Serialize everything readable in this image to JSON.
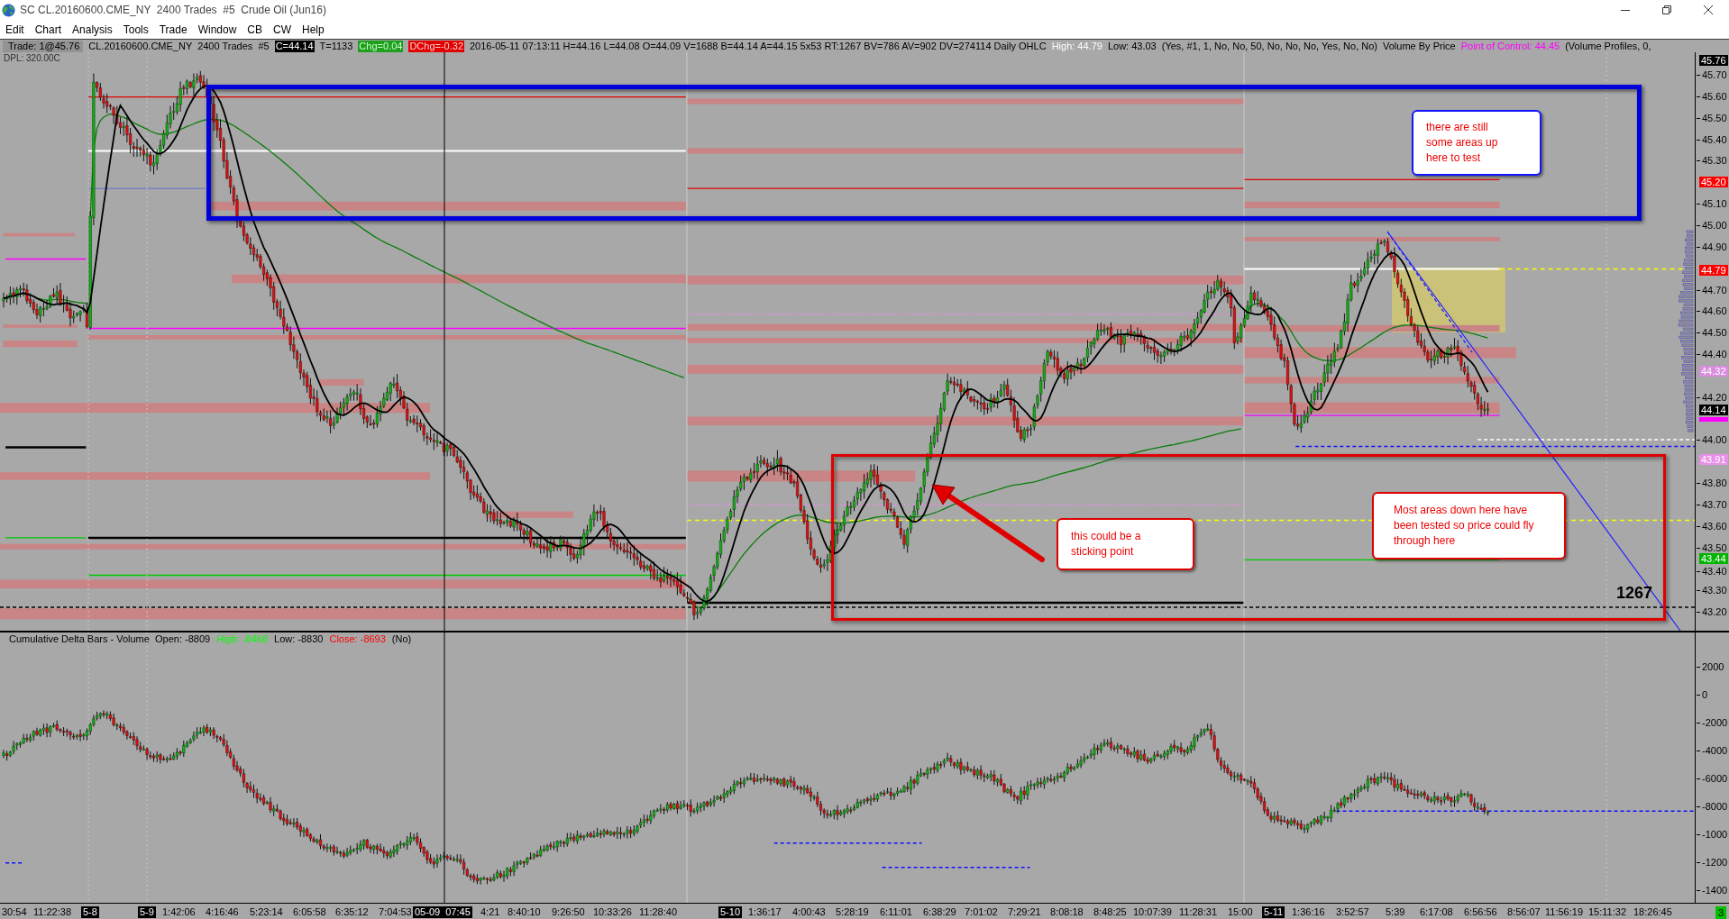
{
  "window": {
    "title": "SC CL.20160600.CME_NY  2400 Trades  #5  Crude Oil (Jun16)"
  },
  "menu": [
    "Edit",
    "Chart",
    "Analysis",
    "Tools",
    "Trade",
    "Window",
    "CB",
    "CW",
    "Help"
  ],
  "info_bar": [
    {
      "text": "Trade: 1@45.76",
      "kind": "trade"
    },
    {
      "text": "CL.20160600.CME_NY  2400 Trades  #5",
      "kind": "plain"
    },
    {
      "text": "C=44.14",
      "kind": "last"
    },
    {
      "text": "T=1133",
      "kind": "plain"
    },
    {
      "text": "Chg=0.04",
      "kind": "up"
    },
    {
      "text": "DChg=-0.32",
      "kind": "down"
    },
    {
      "text": "2016-05-11 07:13:11 H=44.16 L=44.08 O=44.09 V=1688 B=44.14 A=44.15 5x53 RT:1267 BV=786 AV=902 DV=274114 Daily OHLC",
      "kind": "plain"
    },
    {
      "text": "High: 44.79",
      "kind": "high"
    },
    {
      "text": "Low: 43.03",
      "kind": "plain"
    },
    {
      "text": "(Yes, #1, 1, No, No, 50, No, No, No, Yes, No, No)",
      "kind": "plain"
    },
    {
      "text": "Volume By Price",
      "kind": "plain"
    },
    {
      "text": "Point of Control: 44.45",
      "kind": "poc"
    },
    {
      "text": "(Volume Profiles, 0,",
      "kind": "plain"
    }
  ],
  "main_chart": {
    "study_label": "DPL: 320.00C",
    "bar_counter": "1267",
    "annotations": [
      {
        "text": "there are still some areas up here to test",
        "color": "#1414ff"
      },
      {
        "text": "this could be a sticking point",
        "color": "#e00000"
      },
      {
        "text": "Most areas down here have been tested so price could fly through here",
        "color": "#e00000"
      }
    ]
  },
  "price_axis": {
    "labels": [
      "45.70",
      "45.60",
      "45.50",
      "45.40",
      "45.30",
      "45.10",
      "45.00",
      "44.90",
      "44.70",
      "44.60",
      "44.50",
      "44.40",
      "44.20",
      "44.00",
      "43.80",
      "43.70",
      "43.60",
      "43.50",
      "43.40",
      "43.30",
      "43.20"
    ],
    "markers": [
      {
        "text": "45.76",
        "color": "#000000"
      },
      {
        "text": "45.20",
        "color": "#ff0000"
      },
      {
        "text": "44.79",
        "color": "#ff0000"
      },
      {
        "text": "44.32",
        "color": "#d98ddc"
      },
      {
        "text": "44.14",
        "color": "#000000"
      },
      {
        "text": "43.91",
        "color": "#e890e8"
      },
      {
        "text": "43.44",
        "color": "#00b400"
      }
    ]
  },
  "lower_panel": {
    "header": [
      {
        "text": "Cumulative Delta Bars - Volume  Open: -8809",
        "kind": "plain"
      },
      {
        "text": "High: -8468",
        "kind": "high"
      },
      {
        "text": "Low: -8830",
        "kind": "plain"
      },
      {
        "text": "Close: -8693",
        "kind": "close"
      },
      {
        "text": "(No)",
        "kind": "plain"
      }
    ],
    "axis_labels": [
      "2000",
      "0",
      "-2000",
      "-4000",
      "-6000",
      "-8000",
      "-1000",
      "-1200",
      "-1400"
    ]
  },
  "time_axis": [
    {
      "text": "30:54",
      "kind": "time"
    },
    {
      "text": "11:22:38",
      "kind": "time"
    },
    {
      "text": "5-8",
      "kind": "date"
    },
    {
      "text": "5-9",
      "kind": "date"
    },
    {
      "text": "1:42:06",
      "kind": "time"
    },
    {
      "text": "4:16:46",
      "kind": "time"
    },
    {
      "text": "5:23:14",
      "kind": "time"
    },
    {
      "text": "6:05:58",
      "kind": "time"
    },
    {
      "text": "6:35:12",
      "kind": "time"
    },
    {
      "text": "7:04:53",
      "kind": "time"
    },
    {
      "text": "05-09  07:45",
      "kind": "cursor"
    },
    {
      "text": "4:21",
      "kind": "time"
    },
    {
      "text": "8:40:10",
      "kind": "time"
    },
    {
      "text": "9:26:50",
      "kind": "time"
    },
    {
      "text": "10:33:26",
      "kind": "time"
    },
    {
      "text": "11:28:40",
      "kind": "time"
    },
    {
      "text": "5-10",
      "kind": "date"
    },
    {
      "text": "1:36:17",
      "kind": "time"
    },
    {
      "text": "4:00:43",
      "kind": "time"
    },
    {
      "text": "5:28:19",
      "kind": "time"
    },
    {
      "text": "6:11:01",
      "kind": "time"
    },
    {
      "text": "6:38:29",
      "kind": "time"
    },
    {
      "text": "7:01:02",
      "kind": "time"
    },
    {
      "text": "7:29:21",
      "kind": "time"
    },
    {
      "text": "8:08:18",
      "kind": "time"
    },
    {
      "text": "8:48:25",
      "kind": "time"
    },
    {
      "text": "10:07:39",
      "kind": "time"
    },
    {
      "text": "11:28:31",
      "kind": "time"
    },
    {
      "text": "15:00",
      "kind": "time"
    },
    {
      "text": "5-11",
      "kind": "date"
    },
    {
      "text": "1:36:16",
      "kind": "time"
    },
    {
      "text": "3:52:57",
      "kind": "time"
    },
    {
      "text": "5:39",
      "kind": "time"
    },
    {
      "text": "6:17:08",
      "kind": "time"
    },
    {
      "text": "6:56:56",
      "kind": "time"
    },
    {
      "text": "8:56:07",
      "kind": "time"
    },
    {
      "text": "11:56:19",
      "kind": "time"
    },
    {
      "text": "15:11:32",
      "kind": "time"
    },
    {
      "text": "18:26:45",
      "kind": "time"
    }
  ],
  "status_badge": "3"
}
